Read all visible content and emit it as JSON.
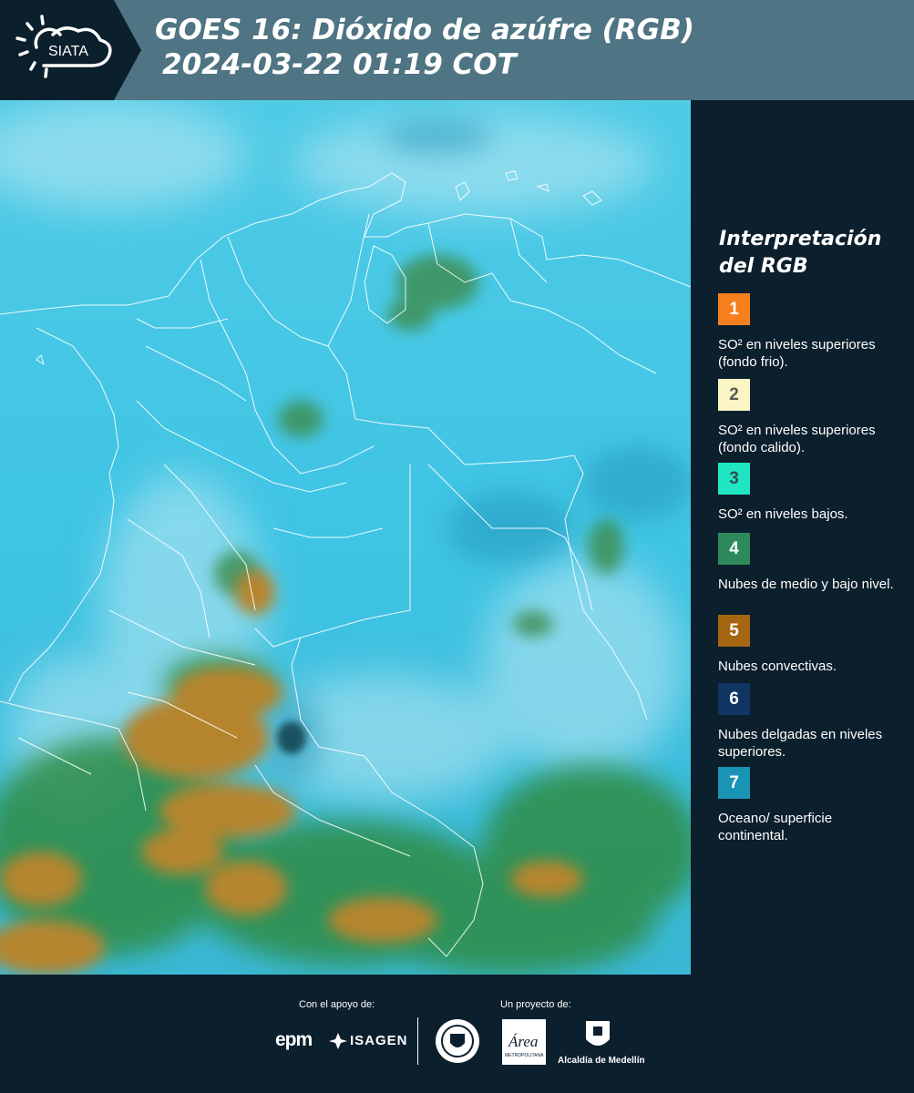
{
  "header": {
    "logo_text": "SIATA",
    "title_line1": "GOES 16: Dióxido de azúfre (RGB)",
    "title_line2": "2024-03-22 01:19 COT"
  },
  "legend": {
    "title": "Interpretación del RGB",
    "items": [
      {
        "number": "1",
        "color": "#f7801e",
        "number_color": "#ffffff",
        "text": "SO² en niveles superiores (fondo frio)."
      },
      {
        "number": "2",
        "color": "#fbf4c4",
        "number_color": "#5a5a5a",
        "text": "SO² en niveles superiores (fondo calido)."
      },
      {
        "number": "3",
        "color": "#1fe5c2",
        "number_color": "#2f4f4f",
        "text": "SO² en niveles bajos."
      },
      {
        "number": "4",
        "color": "#2e8a5b",
        "number_color": "#ffffff",
        "text": "Nubes de medio y bajo nivel."
      },
      {
        "number": "5",
        "color": "#a46611",
        "number_color": "#ffffff",
        "text": "Nubes convectivas."
      },
      {
        "number": "6",
        "color": "#103562",
        "number_color": "#ffffff",
        "text": "Nubes delgadas en niveles superiores."
      },
      {
        "number": "7",
        "color": "#1994b4",
        "number_color": "#ffffff",
        "text": "Oceano/ superficie continental."
      }
    ]
  },
  "footer": {
    "support_label": "Con el apoyo de:",
    "project_label": "Un proyecto de:",
    "epm_text": "epm",
    "isagen_text": "ISAGEN",
    "area_text": "Área",
    "area_subtitle": "METROPOLITANA",
    "alcaldia_text": "Alcaldía de Medellín"
  },
  "colors": {
    "header_bg": "#4f7483",
    "panel_bg": "#0c1f2d",
    "sky_cyan": "#37c3e5",
    "cloud_white": "#b9e6f2",
    "convective_orange": "#b8862e",
    "low_cloud_green": "#2e8a3c"
  }
}
